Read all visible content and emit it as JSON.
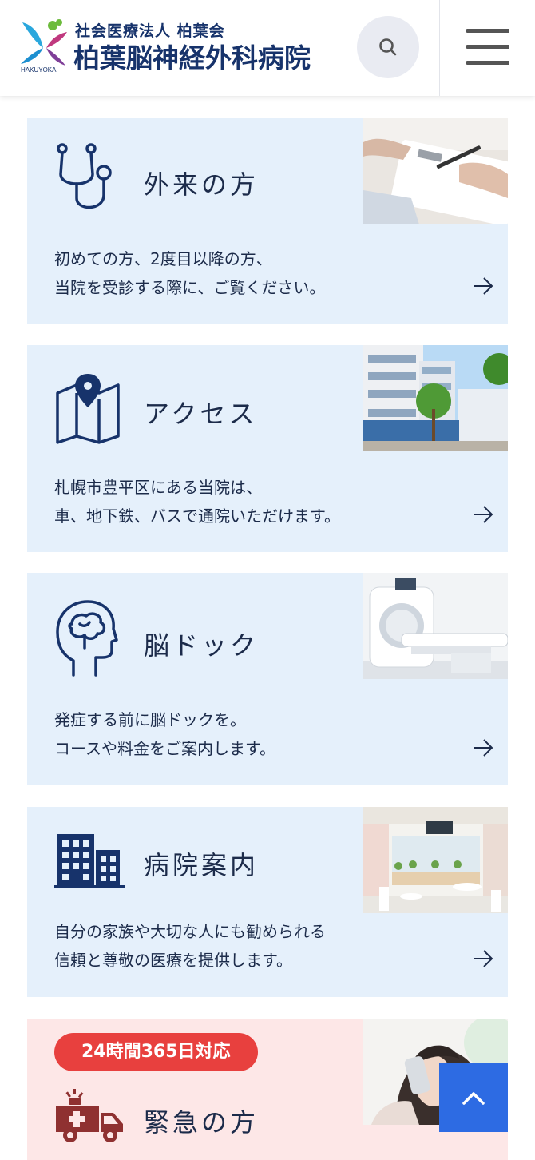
{
  "header": {
    "logo_sub": "社会医療法人 柏葉会",
    "logo_title": "柏葉脳神経外科病院",
    "logo_caption": "HAKUYOKAI",
    "search_icon": "search-icon",
    "menu_icon": "hamburger-menu-icon"
  },
  "cards": [
    {
      "title": "外来の方",
      "desc_line1": "初めての方、2度目以降の方、",
      "desc_line2": "当院を受診する際に、ご覧ください。",
      "icon": "stethoscope-icon",
      "photo": "clipboard-writing-photo"
    },
    {
      "title": "アクセス",
      "desc_line1": "札幌市豊平区にある当院は、",
      "desc_line2": "車、地下鉄、バスで通院いただけます。",
      "icon": "map-pin-icon",
      "photo": "hospital-building-photo"
    },
    {
      "title": "脳ドック",
      "desc_line1": "発症する前に脳ドックを。",
      "desc_line2": "コースや料金をご案内します。",
      "icon": "brain-head-icon",
      "photo": "mri-scanner-photo"
    },
    {
      "title": "病院案内",
      "desc_line1": "自分の家族や大切な人にも勧められる",
      "desc_line2": "信頼と尊敬の医療を提供します。",
      "icon": "building-icon",
      "photo": "hospital-lobby-photo"
    },
    {
      "title": "緊急の方",
      "badge": "24時間365日対応",
      "icon": "ambulance-icon",
      "photo": "woman-on-phone-photo"
    }
  ],
  "colors": {
    "navy": "#17336b",
    "card_blue": "#e5f0fb",
    "card_pink": "#fde7e7",
    "badge_red": "#e8403e",
    "ambulance_red": "#8f3131",
    "scroll_top_blue": "#2d6be3"
  },
  "scroll_top_icon": "chevron-up-icon"
}
